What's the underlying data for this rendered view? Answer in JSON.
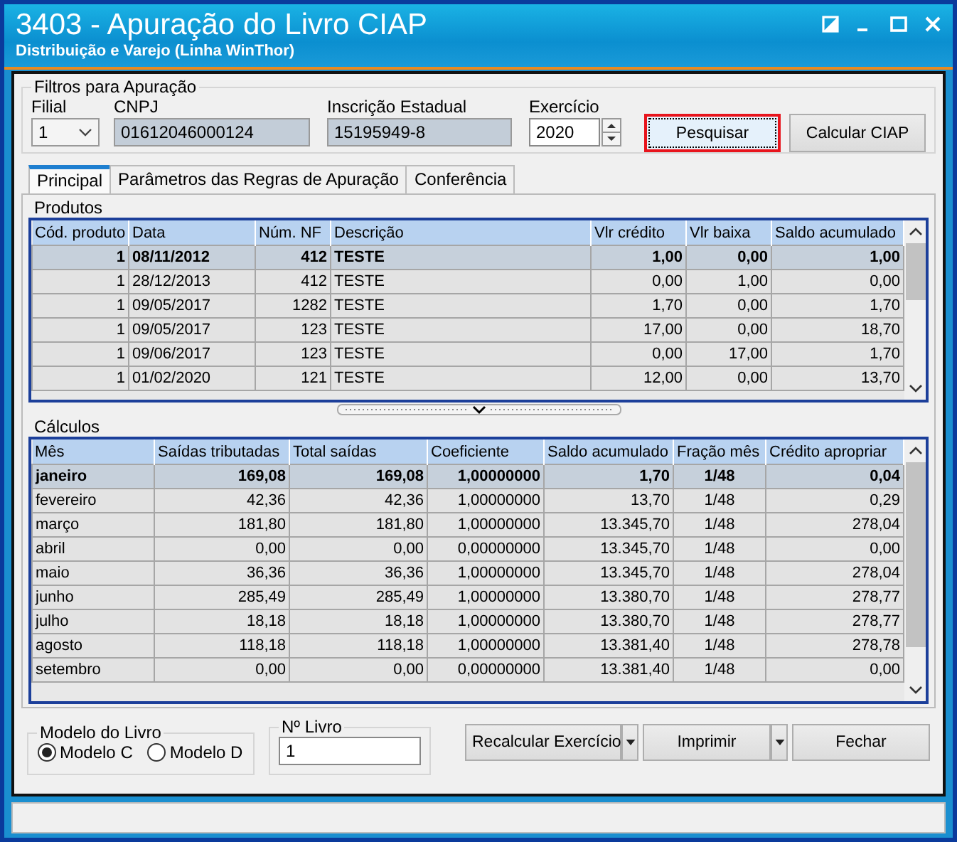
{
  "window": {
    "title": "3403 - Apuração do Livro CIAP",
    "subtitle": "Distribuição e Varejo (Linha WinThor)"
  },
  "filters": {
    "legend": "Filtros para Apuração",
    "filial": {
      "label": "Filial",
      "value": "1"
    },
    "cnpj": {
      "label": "CNPJ",
      "value": "01612046000124"
    },
    "ie": {
      "label": "Inscrição Estadual",
      "value": "15195949-8"
    },
    "exercicio": {
      "label": "Exercício",
      "value": "2020"
    },
    "buttons": [
      {
        "label": "Pesquisar",
        "focused": true
      },
      {
        "label": "Calcular CIAP",
        "focused": false
      }
    ]
  },
  "tabs": [
    {
      "label": "Principal",
      "selected": true
    },
    {
      "label": "Parâmetros das Regras de Apuração",
      "selected": false
    },
    {
      "label": "Conferência",
      "selected": false
    }
  ],
  "produtos": {
    "title": "Produtos",
    "columns": [
      "Cód. produto",
      "Data",
      "Núm. NF",
      "Descrição",
      "Vlr crédito",
      "Vlr baixa",
      "Saldo acumulado"
    ],
    "rows": [
      {
        "cells": [
          "1",
          "08/11/2012",
          "412",
          "TESTE",
          "1,00",
          "0,00",
          "1,00"
        ],
        "selected": true
      },
      {
        "cells": [
          "1",
          "28/12/2013",
          "412",
          "TESTE",
          "0,00",
          "1,00",
          "0,00"
        ],
        "selected": false
      },
      {
        "cells": [
          "1",
          "09/05/2017",
          "1282",
          "TESTE",
          "1,70",
          "0,00",
          "1,70"
        ],
        "selected": false
      },
      {
        "cells": [
          "1",
          "09/05/2017",
          "123",
          "TESTE",
          "17,00",
          "0,00",
          "18,70"
        ],
        "selected": false
      },
      {
        "cells": [
          "1",
          "09/06/2017",
          "123",
          "TESTE",
          "0,00",
          "17,00",
          "1,70"
        ],
        "selected": false
      },
      {
        "cells": [
          "1",
          "01/02/2020",
          "121",
          "TESTE",
          "12,00",
          "0,00",
          "13,70"
        ],
        "selected": false
      }
    ]
  },
  "calculos": {
    "title": "Cálculos",
    "columns": [
      "Mês",
      "Saídas tributadas",
      "Total saídas",
      "Coeficiente",
      "Saldo acumulado",
      "Fração mês",
      "Crédito apropriar"
    ],
    "rows": [
      {
        "cells": [
          "janeiro",
          "169,08",
          "169,08",
          "1,00000000",
          "1,70",
          "1/48",
          "0,04"
        ],
        "selected": true
      },
      {
        "cells": [
          "fevereiro",
          "42,36",
          "42,36",
          "1,00000000",
          "13,70",
          "1/48",
          "0,29"
        ],
        "selected": false
      },
      {
        "cells": [
          "março",
          "181,80",
          "181,80",
          "1,00000000",
          "13.345,70",
          "1/48",
          "278,04"
        ],
        "selected": false
      },
      {
        "cells": [
          "abril",
          "0,00",
          "0,00",
          "0,00000000",
          "13.345,70",
          "1/48",
          "0,00"
        ],
        "selected": false
      },
      {
        "cells": [
          "maio",
          "36,36",
          "36,36",
          "1,00000000",
          "13.345,70",
          "1/48",
          "278,04"
        ],
        "selected": false
      },
      {
        "cells": [
          "junho",
          "285,49",
          "285,49",
          "1,00000000",
          "13.380,70",
          "1/48",
          "278,77"
        ],
        "selected": false
      },
      {
        "cells": [
          "julho",
          "18,18",
          "18,18",
          "1,00000000",
          "13.380,70",
          "1/48",
          "278,77"
        ],
        "selected": false
      },
      {
        "cells": [
          "agosto",
          "118,18",
          "118,18",
          "1,00000000",
          "13.381,40",
          "1/48",
          "278,78"
        ],
        "selected": false
      },
      {
        "cells": [
          "setembro",
          "0,00",
          "0,00",
          "0,00000000",
          "13.381,40",
          "1/48",
          "0,00"
        ],
        "selected": false
      }
    ]
  },
  "modelo": {
    "legend": "Modelo do Livro",
    "options": [
      {
        "label": "Modelo C",
        "selected": true
      },
      {
        "label": "Modelo D",
        "selected": false
      }
    ]
  },
  "livro": {
    "legend": "Nº Livro",
    "value": "1"
  },
  "actions": [
    {
      "label": "Recalcular Exercício",
      "has_menu": true
    },
    {
      "label": "Imprimir",
      "has_menu": true
    },
    {
      "label": "Fechar",
      "has_menu": false
    }
  ]
}
